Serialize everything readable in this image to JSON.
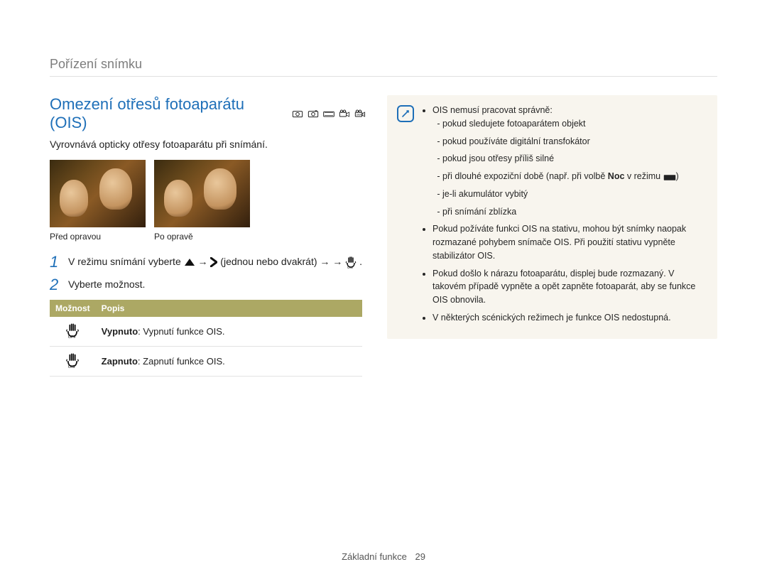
{
  "breadcrumb": "Pořízení snímku",
  "section_title": "Omezení otřesů fotoaparátu (OIS)",
  "intro": "Vyrovnává opticky otřesy fotoaparátu při snímání.",
  "mode_icons": [
    "mode-auto",
    "mode-program",
    "mode-scene",
    "mode-movie",
    "mode-smart"
  ],
  "captions": {
    "before": "Před opravou",
    "after": "Po opravě"
  },
  "steps": [
    {
      "num": "1",
      "parts": [
        "V režimu snímání vyberte ",
        " → ",
        " (jednou nebo dvakrát) → ",
        "."
      ]
    },
    {
      "num": "2",
      "parts": [
        "Vyberte možnost."
      ]
    }
  ],
  "table": {
    "headers": [
      "Možnost",
      "Popis"
    ],
    "rows": [
      {
        "icon": "ois-off",
        "label": "Vypnuto",
        "desc": ": Vypnutí funkce OIS."
      },
      {
        "icon": "ois-on",
        "label": "Zapnuto",
        "desc": ": Zapnutí funkce OIS."
      }
    ]
  },
  "note": {
    "items": [
      {
        "lead": "OIS nemusí pracovat správně:",
        "subs": [
          "pokud sledujete fotoaparátem objekt",
          "pokud používáte digitální transfokátor",
          "pokud jsou otřesy příliš silné",
          {
            "pre": "při dlouhé expoziční době (např. při volbě ",
            "bold": "Noc",
            "mid": " v režimu ",
            "icon": true,
            "post": ")"
          },
          "je-li akumulátor vybitý",
          "při snímání zblízka"
        ]
      },
      {
        "text": "Pokud požíváte funkci OIS na stativu, mohou být snímky naopak rozmazané pohybem snímače OIS. Při použití stativu vypněte stabilizátor OIS."
      },
      {
        "text": "Pokud došlo k nárazu fotoaparátu, displej bude rozmazaný. V takovém případě vypněte a opět zapněte fotoaparát, aby se funkce OIS obnovila."
      },
      {
        "text": "V některých scénických režimech je funkce OIS nedostupná."
      }
    ]
  },
  "footer": {
    "label": "Základní funkce",
    "page": "29"
  }
}
